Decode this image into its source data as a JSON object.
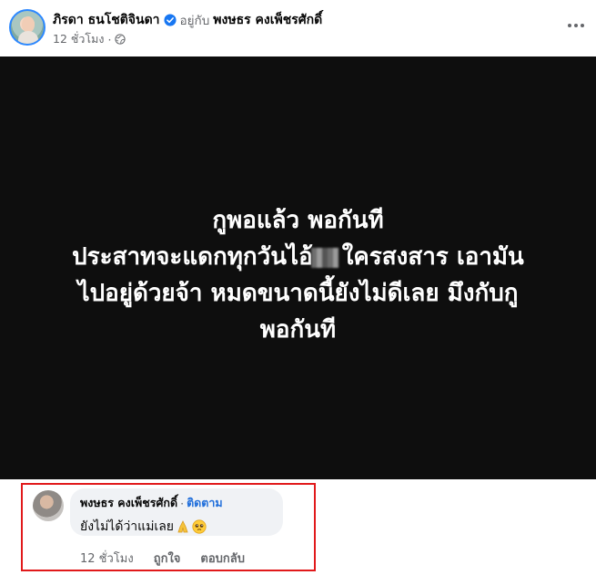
{
  "post": {
    "author": "ภิรดา ธนโชติจินดา",
    "with_text": "อยู่กับ",
    "tagged": "พงษธร คงเพ็ชรศักดิ์",
    "timestamp": "12 ชั่วโมง",
    "image_text_lines": [
      "กูพอแล้ว พอกันที",
      "ประสาทจะแดกทุกวันไอ้",
      "ใครสงสาร เอามัน",
      "ไปอยู่ด้วยจ้า หมดขนาดนี้ยังไม่ดีเลย มึงกับกู",
      "พอกันที"
    ]
  },
  "comment": {
    "author": "พงษธร คงเพ็ชรศักดิ์",
    "separator": "·",
    "follow_label": "ติดตาม",
    "text": "ยังไม่ได้ว่าแม่เลย",
    "time": "12 ชั่วโมง",
    "like_label": "ถูกใจ",
    "reply_label": "ตอบกลับ"
  },
  "colors": {
    "highlight_border": "#e1191b",
    "link_blue": "#216fdb",
    "verified_blue": "#1877f2"
  }
}
